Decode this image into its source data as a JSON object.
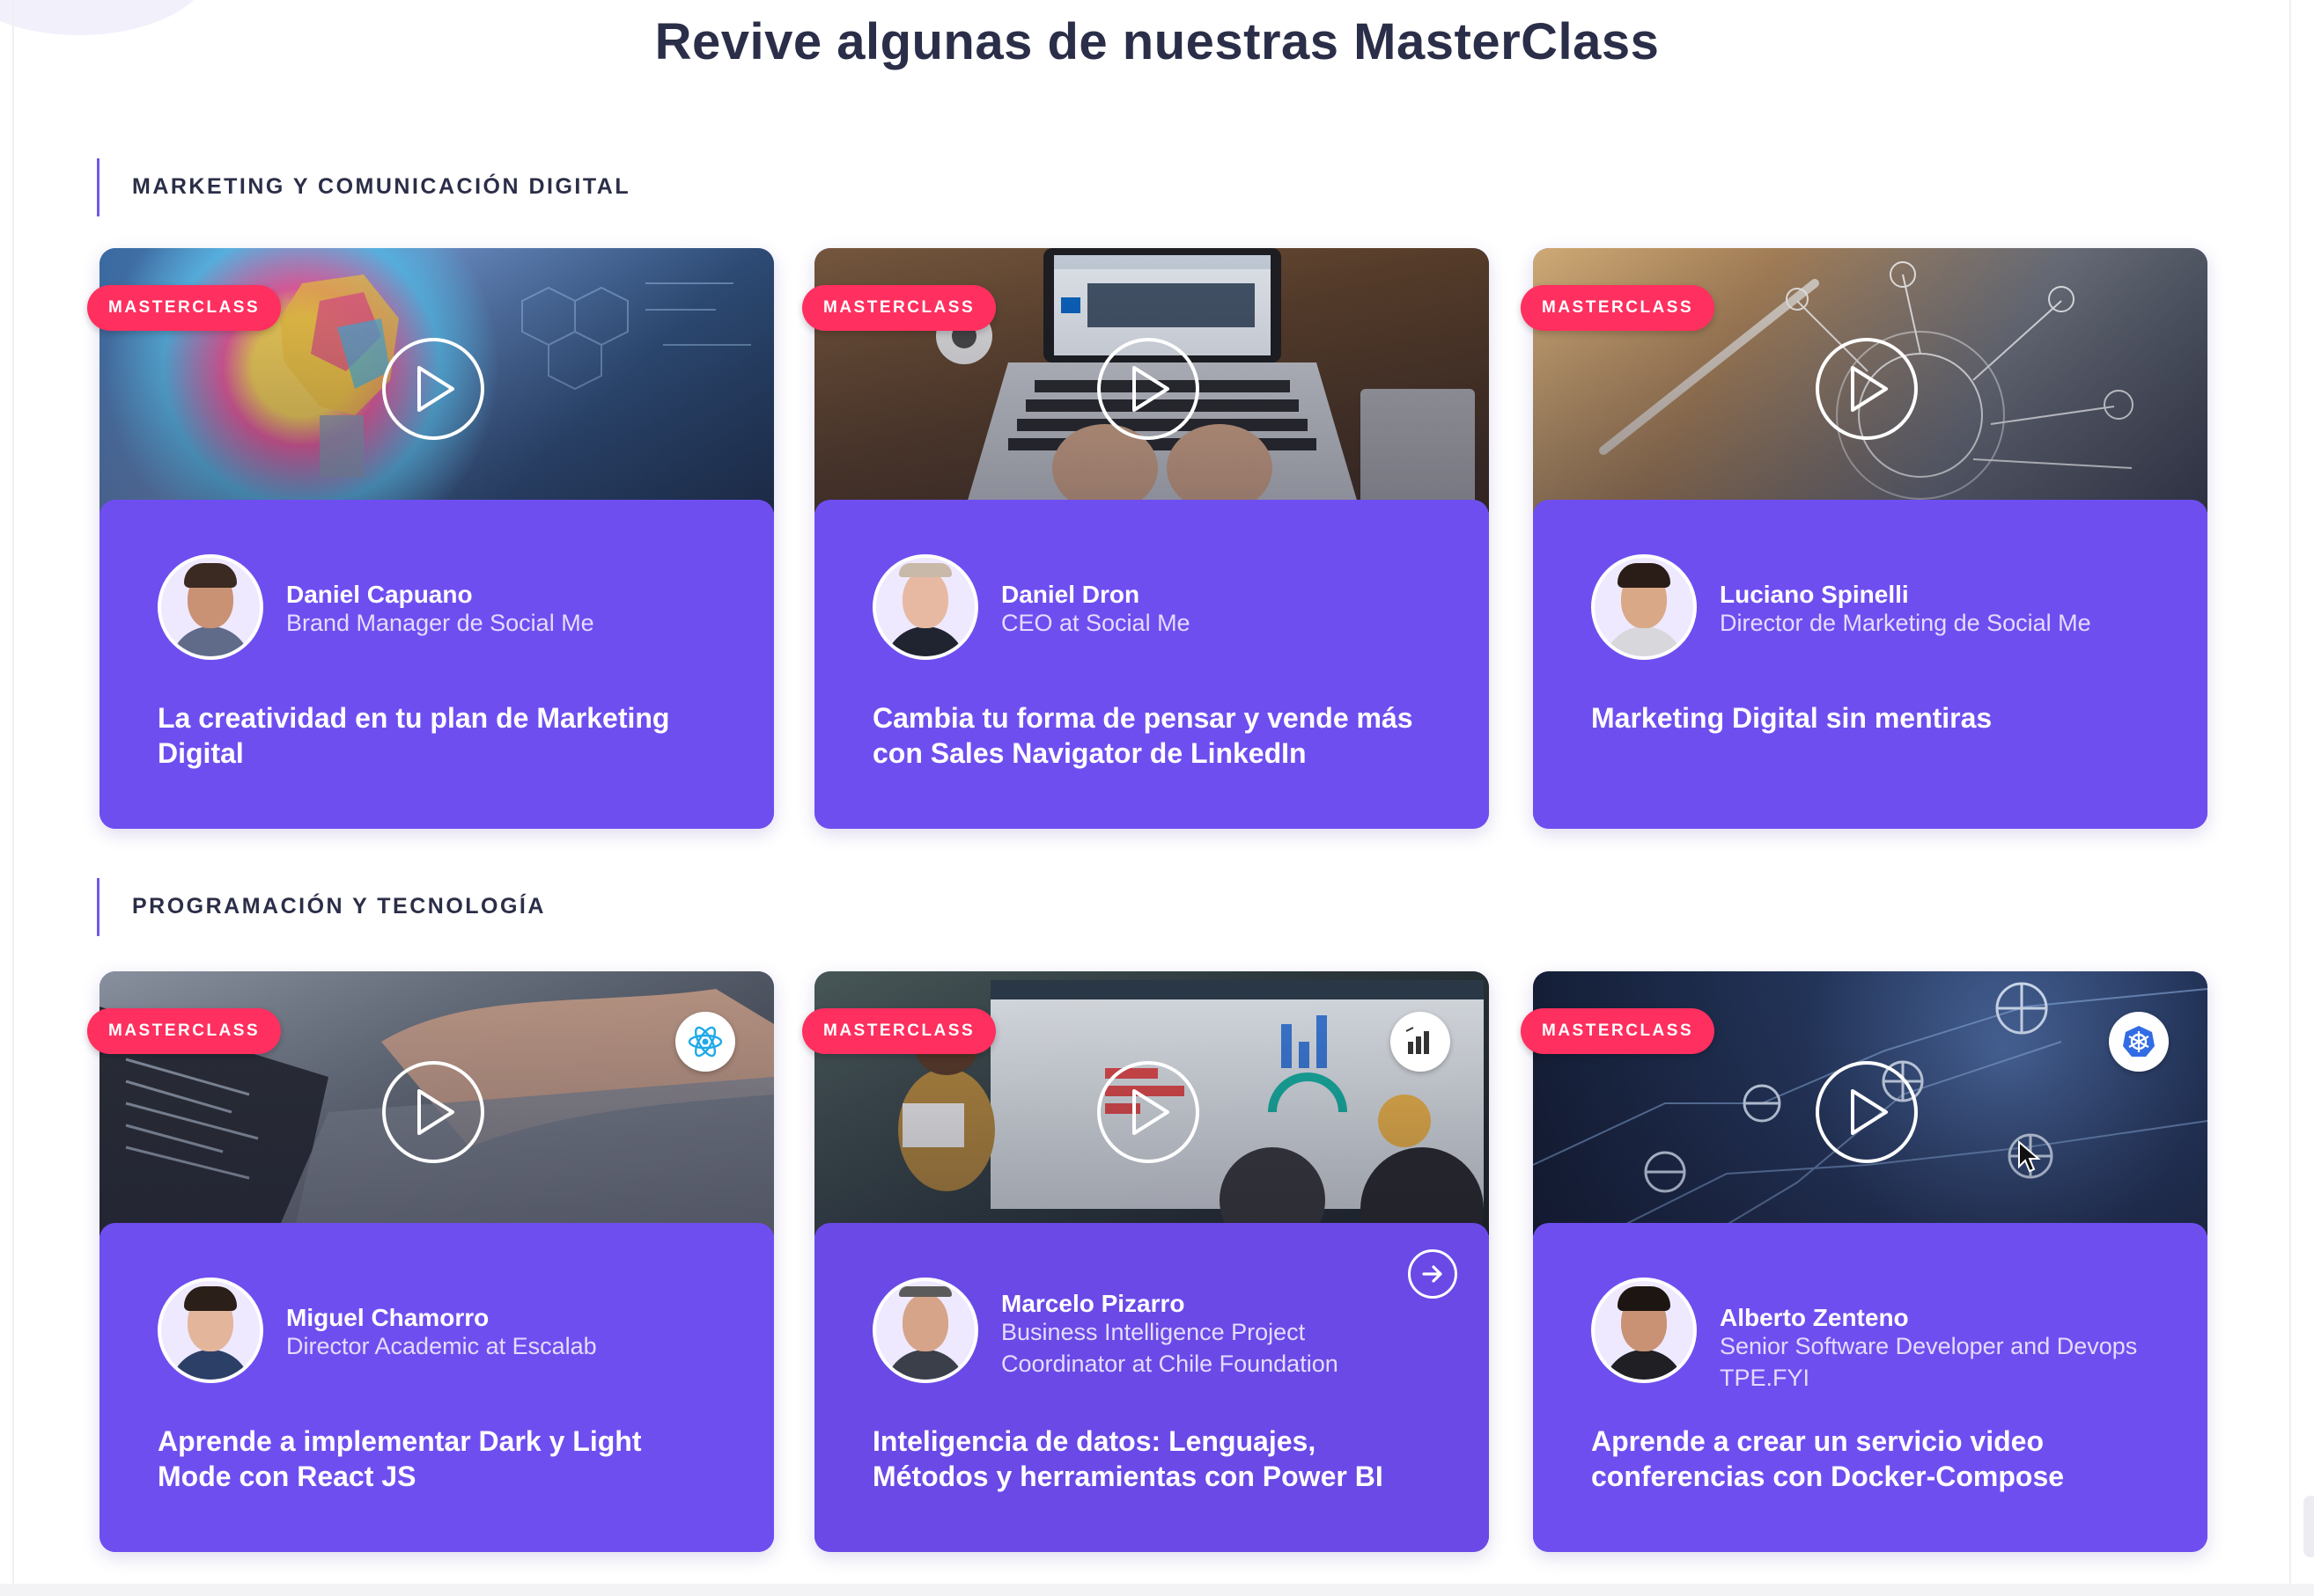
{
  "page": {
    "title": "Revive algunas de nuestras MasterClass"
  },
  "sections": [
    {
      "label": "MARKETING Y COMUNICACIÓN DIGITAL",
      "cards": [
        {
          "badge": "MASTERCLASS",
          "speaker_name": "Daniel Capuano",
          "speaker_role": "Brand Manager de Social Me",
          "title": "La creatividad en tu plan de Marketing Digital",
          "thumb_icon": "lightbulb-art"
        },
        {
          "badge": "MASTERCLASS",
          "speaker_name": "Daniel Dron",
          "speaker_role": "CEO at Social Me",
          "title": "Cambia tu forma de pensar y vende más con Sales Navigator de LinkedIn",
          "thumb_icon": "laptop-linkedin"
        },
        {
          "badge": "MASTERCLASS",
          "speaker_name": "Luciano Spinelli",
          "speaker_role": "Director de Marketing de Social Me",
          "title": "Marketing Digital sin mentiras",
          "thumb_icon": "digital-network"
        }
      ]
    },
    {
      "label": "PROGRAMACIÓN Y TECNOLOGÍA",
      "cards": [
        {
          "badge": "MASTERCLASS",
          "speaker_name": "Miguel Chamorro",
          "speaker_role": "Director Academic at Escalab",
          "title": "Aprende a implementar Dark y Light Mode con React JS",
          "tech_icon": "react-icon"
        },
        {
          "badge": "MASTERCLASS",
          "speaker_name": "Marcelo Pizarro",
          "speaker_role": "Business Intelligence Project Coordinator at Chile Foundation",
          "title": "Inteligencia de datos: Lenguajes, Métodos y herramientas con Power BI",
          "tech_icon": "power-bi-icon",
          "action_icon": "arrow-right-circle-icon"
        },
        {
          "badge": "MASTERCLASS",
          "speaker_name": "Alberto Zenteno",
          "speaker_role": "Senior Software Developer and Devops TPE.FYI",
          "title": "Aprende a crear un servicio video conferencias con Docker-Compose",
          "tech_icon": "kubernetes-icon"
        }
      ]
    }
  ],
  "colors": {
    "card_bg": "#6f4ef0",
    "badge_bg": "#ff2f5f",
    "title_text": "#2b2e48",
    "section_bar": "#6d5ae6"
  }
}
